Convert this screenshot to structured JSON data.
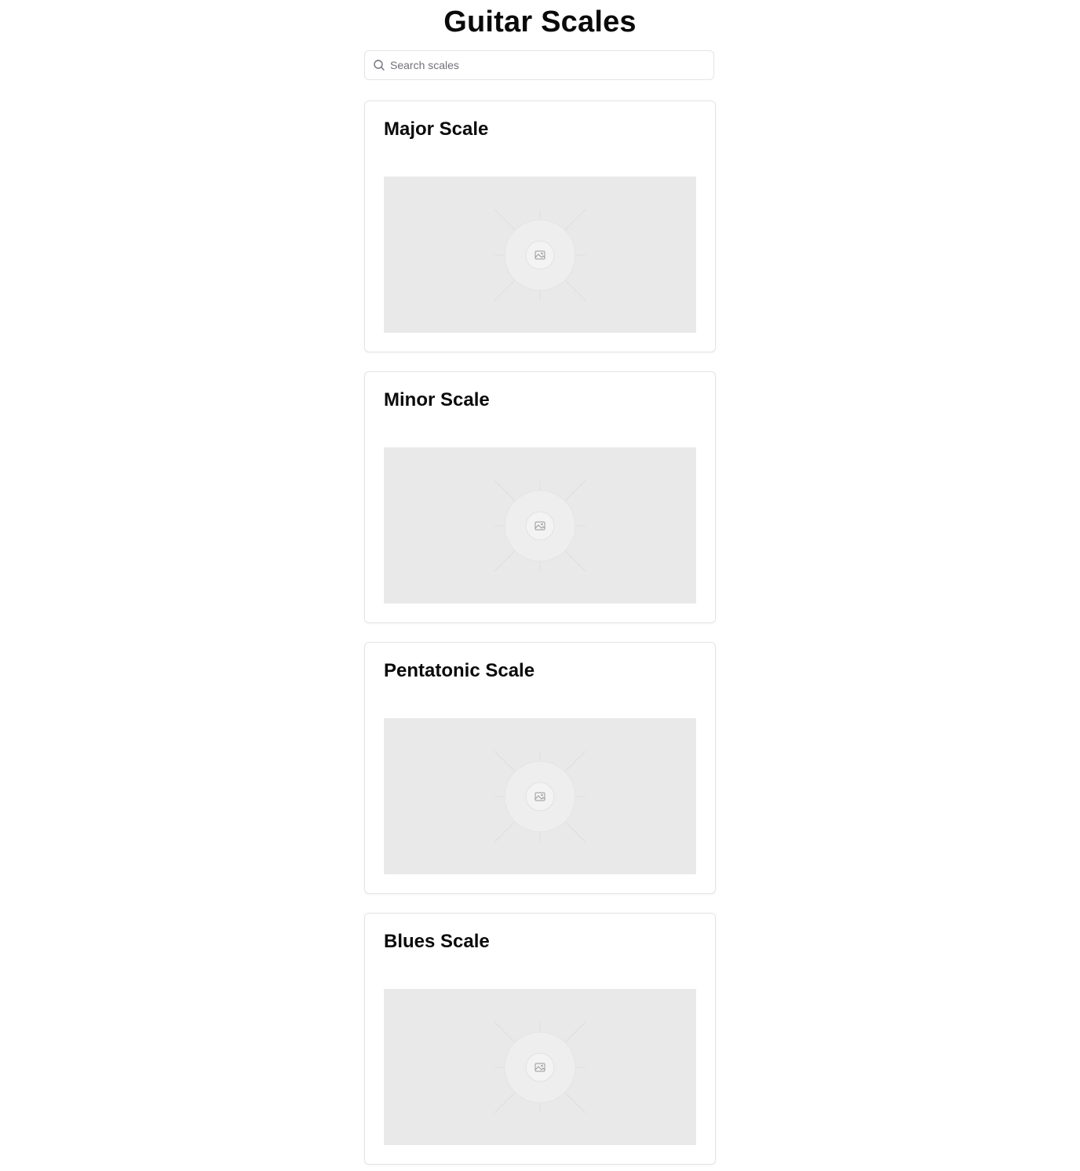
{
  "page": {
    "title": "Guitar Scales"
  },
  "search": {
    "placeholder": "Search scales",
    "value": "",
    "icon": "search-icon"
  },
  "scales": [
    {
      "name": "Major Scale",
      "image_icon": "image-placeholder-icon"
    },
    {
      "name": "Minor Scale",
      "image_icon": "image-placeholder-icon"
    },
    {
      "name": "Pentatonic Scale",
      "image_icon": "image-placeholder-icon"
    },
    {
      "name": "Blues Scale",
      "image_icon": "image-placeholder-icon"
    }
  ],
  "colors": {
    "border": "#e4e4e7",
    "placeholder_bg": "#e9e9e9",
    "text": "#0a0a0a",
    "muted": "#71717a"
  }
}
